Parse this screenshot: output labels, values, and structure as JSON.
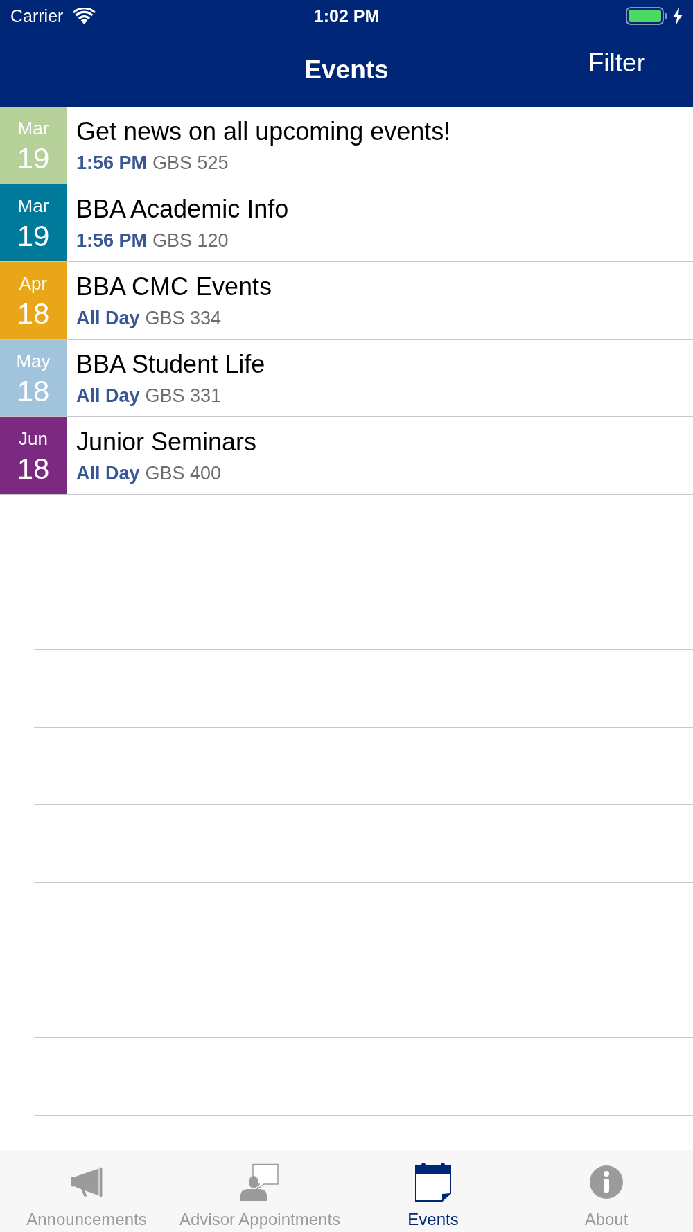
{
  "status_bar": {
    "carrier": "Carrier",
    "time": "1:02 PM"
  },
  "nav_bar": {
    "title": "Events",
    "filter_button": "Filter"
  },
  "events": [
    {
      "month": "Mar",
      "day": "19",
      "color": "#b5d098",
      "title": "Get news on all upcoming events!",
      "time": "1:56 PM",
      "location": "GBS 525"
    },
    {
      "month": "Mar",
      "day": "19",
      "color": "#007a9a",
      "title": "BBA Academic Info",
      "time": "1:56 PM",
      "location": "GBS 120"
    },
    {
      "month": "Apr",
      "day": "18",
      "color": "#e8a618",
      "title": "BBA CMC Events",
      "time": "All Day",
      "location": "GBS 334"
    },
    {
      "month": "May",
      "day": "18",
      "color": "#a1c4dc",
      "title": "BBA Student Life",
      "time": "All Day",
      "location": "GBS 331"
    },
    {
      "month": "Jun",
      "day": "18",
      "color": "#7c2a81",
      "title": "Junior Seminars",
      "time": "All Day",
      "location": "GBS 400"
    }
  ],
  "tab_bar": {
    "tabs": [
      {
        "kind": "megaphone",
        "label": "Announcements",
        "selected": false
      },
      {
        "kind": "advisor",
        "label": "Advisor Appointments",
        "selected": false
      },
      {
        "kind": "calendar",
        "label": "Events",
        "selected": true
      },
      {
        "kind": "info",
        "label": "About",
        "selected": false
      }
    ]
  }
}
